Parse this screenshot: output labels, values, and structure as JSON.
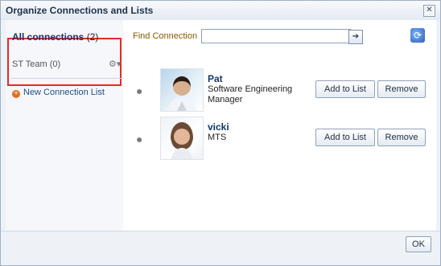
{
  "dialog": {
    "title": "Organize Connections and Lists",
    "close_glyph": "✕"
  },
  "sidebar": {
    "all_connections_label": "All connections",
    "all_connections_count": "(2)",
    "team_label": "ST Team",
    "team_count": "(0)",
    "gear_glyph": "⚙▾",
    "new_list_label": "New Connection List"
  },
  "find": {
    "label": "Find Connection",
    "value": "",
    "placeholder": "",
    "go_glyph": "➔"
  },
  "connections": [
    {
      "name": "Pat",
      "title": "Software Engineering Manager",
      "add_label": "Add to List",
      "remove_label": "Remove"
    },
    {
      "name": "vicki",
      "title": "MTS",
      "add_label": "Add to List",
      "remove_label": "Remove"
    }
  ],
  "footer": {
    "ok_label": "OK"
  },
  "colors": {
    "accent": "#12366a",
    "highlight": "#e52a2a",
    "find_label": "#8a5a00"
  },
  "icons": {
    "close": "close-icon",
    "go": "arrow-right-icon",
    "refresh": "refresh-icon",
    "gear": "gear-icon",
    "presence": "presence-icon",
    "add": "plus-icon"
  }
}
